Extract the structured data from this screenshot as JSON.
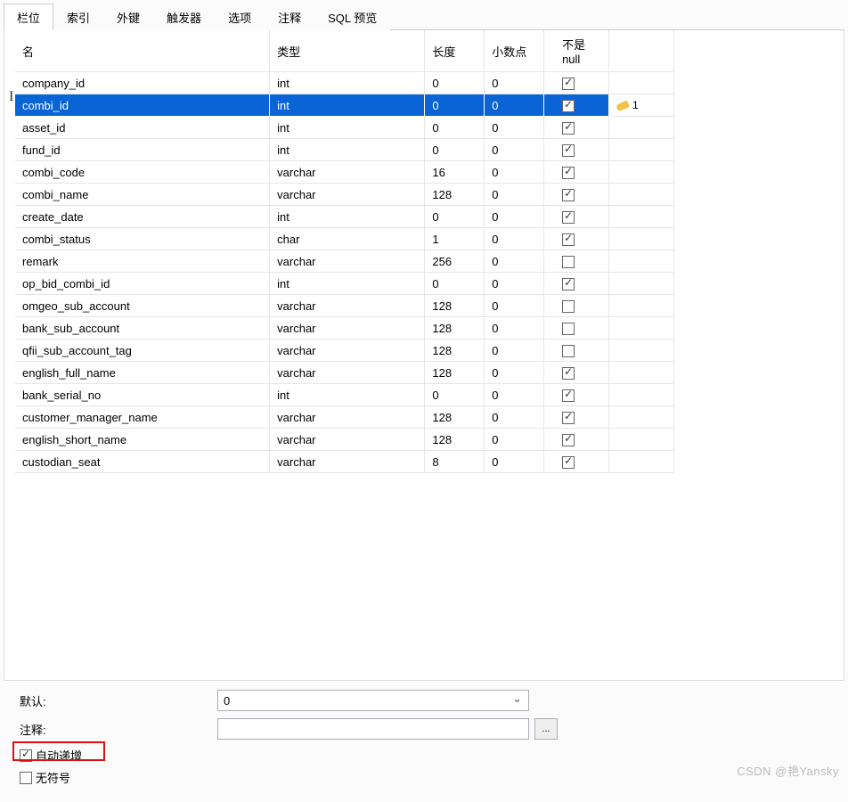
{
  "tabs": [
    {
      "label": "栏位",
      "active": true
    },
    {
      "label": "索引",
      "active": false
    },
    {
      "label": "外键",
      "active": false
    },
    {
      "label": "触发器",
      "active": false
    },
    {
      "label": "选项",
      "active": false
    },
    {
      "label": "注释",
      "active": false
    },
    {
      "label": "SQL 预览",
      "active": false
    }
  ],
  "headers": {
    "name": "名",
    "type": "类型",
    "length": "长度",
    "decimals": "小数点",
    "notnull": "不是 null",
    "key": ""
  },
  "rows": [
    {
      "name": "company_id",
      "type": "int",
      "len": "0",
      "dec": "0",
      "nn": true,
      "key": "",
      "selected": false
    },
    {
      "name": "combi_id",
      "type": "int",
      "len": "0",
      "dec": "0",
      "nn": true,
      "key": "1",
      "selected": true
    },
    {
      "name": "asset_id",
      "type": "int",
      "len": "0",
      "dec": "0",
      "nn": true,
      "key": "",
      "selected": false
    },
    {
      "name": "fund_id",
      "type": "int",
      "len": "0",
      "dec": "0",
      "nn": true,
      "key": "",
      "selected": false
    },
    {
      "name": "combi_code",
      "type": "varchar",
      "len": "16",
      "dec": "0",
      "nn": true,
      "key": "",
      "selected": false
    },
    {
      "name": "combi_name",
      "type": "varchar",
      "len": "128",
      "dec": "0",
      "nn": true,
      "key": "",
      "selected": false
    },
    {
      "name": "create_date",
      "type": "int",
      "len": "0",
      "dec": "0",
      "nn": true,
      "key": "",
      "selected": false
    },
    {
      "name": "combi_status",
      "type": "char",
      "len": "1",
      "dec": "0",
      "nn": true,
      "key": "",
      "selected": false
    },
    {
      "name": "remark",
      "type": "varchar",
      "len": "256",
      "dec": "0",
      "nn": false,
      "key": "",
      "selected": false
    },
    {
      "name": "op_bid_combi_id",
      "type": "int",
      "len": "0",
      "dec": "0",
      "nn": true,
      "key": "",
      "selected": false
    },
    {
      "name": "omgeo_sub_account",
      "type": "varchar",
      "len": "128",
      "dec": "0",
      "nn": false,
      "key": "",
      "selected": false
    },
    {
      "name": "bank_sub_account",
      "type": "varchar",
      "len": "128",
      "dec": "0",
      "nn": false,
      "key": "",
      "selected": false
    },
    {
      "name": "qfii_sub_account_tag",
      "type": "varchar",
      "len": "128",
      "dec": "0",
      "nn": false,
      "key": "",
      "selected": false
    },
    {
      "name": "english_full_name",
      "type": "varchar",
      "len": "128",
      "dec": "0",
      "nn": true,
      "key": "",
      "selected": false
    },
    {
      "name": "bank_serial_no",
      "type": "int",
      "len": "0",
      "dec": "0",
      "nn": true,
      "key": "",
      "selected": false
    },
    {
      "name": "customer_manager_name",
      "type": "varchar",
      "len": "128",
      "dec": "0",
      "nn": true,
      "key": "",
      "selected": false
    },
    {
      "name": "english_short_name",
      "type": "varchar",
      "len": "128",
      "dec": "0",
      "nn": true,
      "key": "",
      "selected": false
    },
    {
      "name": "custodian_seat",
      "type": "varchar",
      "len": "8",
      "dec": "0",
      "nn": true,
      "key": "",
      "selected": false
    }
  ],
  "form": {
    "default_label": "默认:",
    "default_value": "0",
    "comment_label": "注释:",
    "comment_value": "",
    "ellipsis": "...",
    "auto_increment_label": "自动递增",
    "auto_increment_checked": true,
    "unsigned_label": "无符号",
    "unsigned_checked": false
  },
  "watermark": "CSDN @艳Yansky"
}
